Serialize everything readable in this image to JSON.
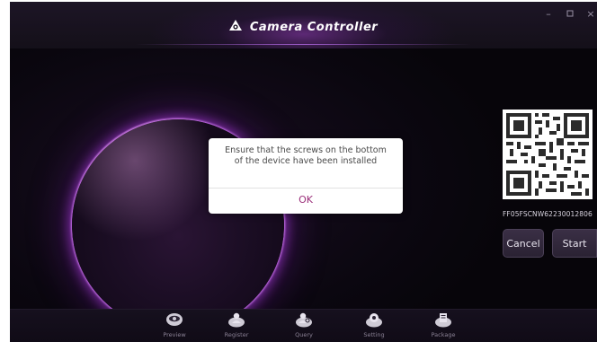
{
  "app": {
    "title": "Camera Controller",
    "logo_icon": "camera-logo-icon"
  },
  "window_controls": {
    "minimize": "–",
    "maximize": "▫",
    "close": "×"
  },
  "device": {
    "serial": "FF05FSCNW62230012806",
    "qr_icon": "qr-code"
  },
  "actions": {
    "cancel_label": "Cancel",
    "start_label": "Start"
  },
  "dialog": {
    "message": "Ensure that the screws on the bottom of the device have been installed",
    "ok_label": "OK"
  },
  "nav": {
    "items": [
      {
        "label": "Preview",
        "icon": "eye-icon"
      },
      {
        "label": "Register",
        "icon": "user-icon"
      },
      {
        "label": "Query",
        "icon": "user-search-icon"
      },
      {
        "label": "Setting",
        "icon": "gear-icon"
      },
      {
        "label": "Package",
        "icon": "package-icon"
      }
    ]
  },
  "colors": {
    "accent": "#9b2f7a",
    "glow": "#b040e0",
    "background": "#08050c"
  }
}
